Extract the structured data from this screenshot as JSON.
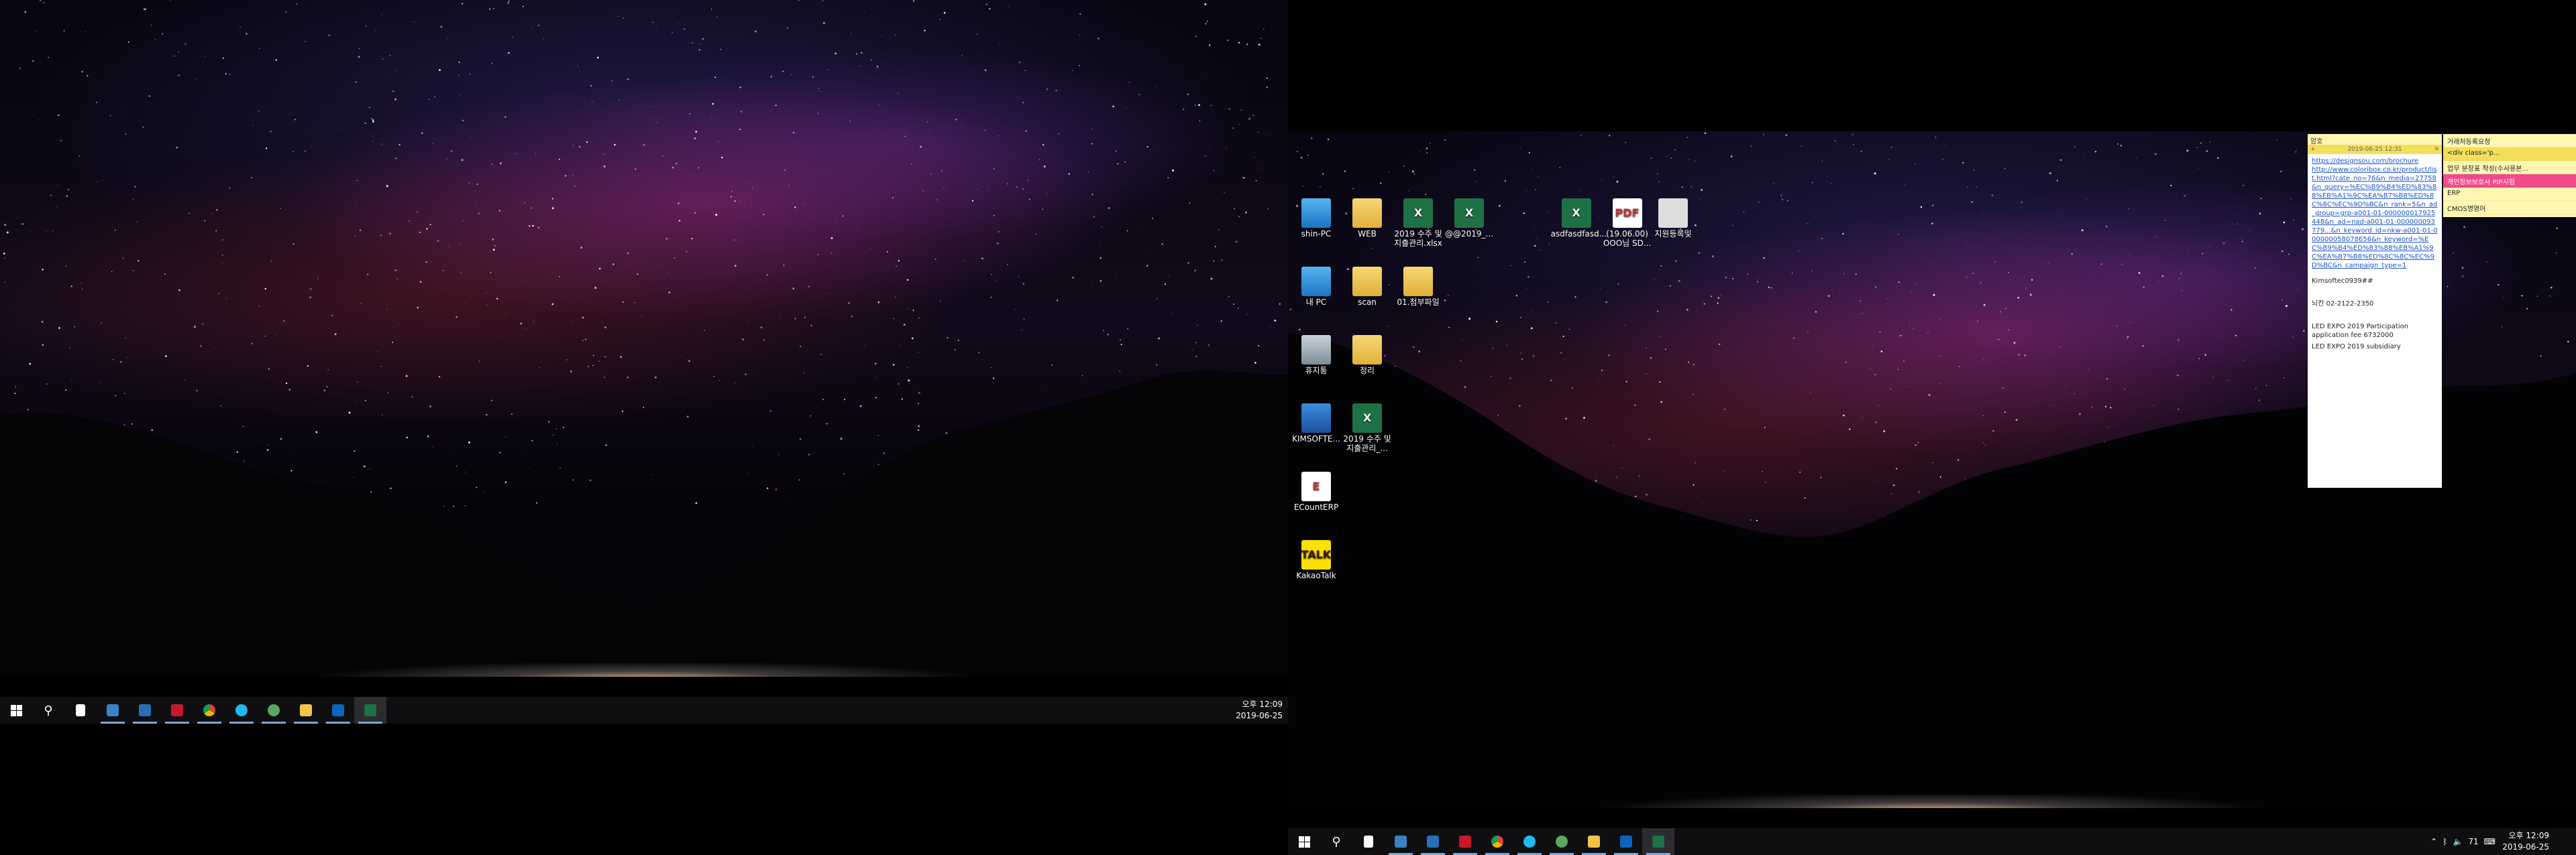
{
  "colors": {
    "taskbar": "#0f0f12",
    "sticky_yellow": "#fff7b1",
    "sticky_header": "#f3df5a",
    "highlight_pink": "#f24a8a",
    "link_blue": "#1a56c9",
    "excel_green": "#1e7145"
  },
  "left_monitor": {
    "taskbar": {
      "clock_time": "오후 12:09",
      "clock_date": "2019-06-25",
      "apps": [
        {
          "icon": "windows-start-icon"
        },
        {
          "icon": "search-icon"
        },
        {
          "icon": "file-icon"
        },
        {
          "icon": "remote-desktop-icon"
        },
        {
          "icon": "store-icon"
        },
        {
          "icon": "flash-icon"
        },
        {
          "icon": "chrome-icon"
        },
        {
          "icon": "ie-icon"
        },
        {
          "icon": "network-icon"
        },
        {
          "icon": "file-explorer-icon"
        },
        {
          "icon": "outlook-icon"
        },
        {
          "icon": "excel-icon"
        }
      ]
    }
  },
  "right_monitor": {
    "desktop_icons": [
      {
        "label": "shin-PC",
        "glyph": ""
      },
      {
        "label": "WEB",
        "glyph": ""
      },
      {
        "label": "2019 수주 및 지출관리.xlsx",
        "glyph": "X"
      },
      {
        "label": "@@2019_...",
        "glyph": "X"
      },
      {
        "label": "asdfasdfasd...",
        "glyph": "X"
      },
      {
        "label": "(19.06.00) OOO님 SD...",
        "glyph": "PDF"
      },
      {
        "label": "지원등록및",
        "glyph": ""
      },
      {
        "label": "내 PC",
        "glyph": ""
      },
      {
        "label": "scan",
        "glyph": ""
      },
      {
        "label": "01.첨부파일",
        "glyph": ""
      },
      {
        "label": "휴지통",
        "glyph": ""
      },
      {
        "label": "정리",
        "glyph": ""
      },
      {
        "label": "KIMSOFTE...",
        "glyph": ""
      },
      {
        "label": "2019 수주 및 지출관리_...",
        "glyph": "X"
      },
      {
        "label": "ECountERP",
        "glyph": "E"
      },
      {
        "label": "KakaoTalk",
        "glyph": "TALK"
      }
    ],
    "taskbar": {
      "clock_time": "오후 12:09",
      "clock_date": "2019-06-25",
      "tray_text": "71",
      "apps": [
        {
          "icon": "windows-start-icon"
        },
        {
          "icon": "search-icon"
        },
        {
          "icon": "file-icon"
        },
        {
          "icon": "remote-desktop-icon"
        },
        {
          "icon": "store-icon"
        },
        {
          "icon": "flash-icon"
        },
        {
          "icon": "chrome-icon"
        },
        {
          "icon": "ie-icon"
        },
        {
          "icon": "network-icon"
        },
        {
          "icon": "file-explorer-icon"
        },
        {
          "icon": "outlook-icon"
        },
        {
          "icon": "excel-icon"
        }
      ]
    }
  },
  "sticky_note_a": {
    "title": "암호",
    "timestamp": "2019-06-25 12:31",
    "links": [
      "https://designsou.com/brochure",
      "http://www.coloribox.co.kr/product/list.html?cate_no=76&n_media=27758&n_query=%EC%B9%B4%ED%83%88%EB%A1%9C%EA%B7%B8%ED%8C%8C%EC%9D%BC&n_rank=5&n_ad_group=grp-a001-01-000000017925448&n_ad=nad-a001-01-000000093779...&n_keyword_id=nkw-a001-01-000000058078656&n_keyword=%EC%B9%B4%ED%83%88%EB%A1%9C%EA%B7%B8%ED%8C%8C%EC%9D%BC&n_campaign_type=1"
    ],
    "lines": [
      "Kimsoftec0939##",
      "",
      "뇌칸 02-2122-2350",
      "",
      "LED EXPO 2019 Participation application fee 6732000",
      "LED EXPO 2019 subsidiary"
    ]
  },
  "sticky_note_b": {
    "rows": [
      "거래처등록요청",
      "<div class='p...",
      "업무 분장표 작성(수사용본...",
      "개인정보보호사 PIP시험",
      "ERP",
      "CMOS명영어"
    ]
  }
}
